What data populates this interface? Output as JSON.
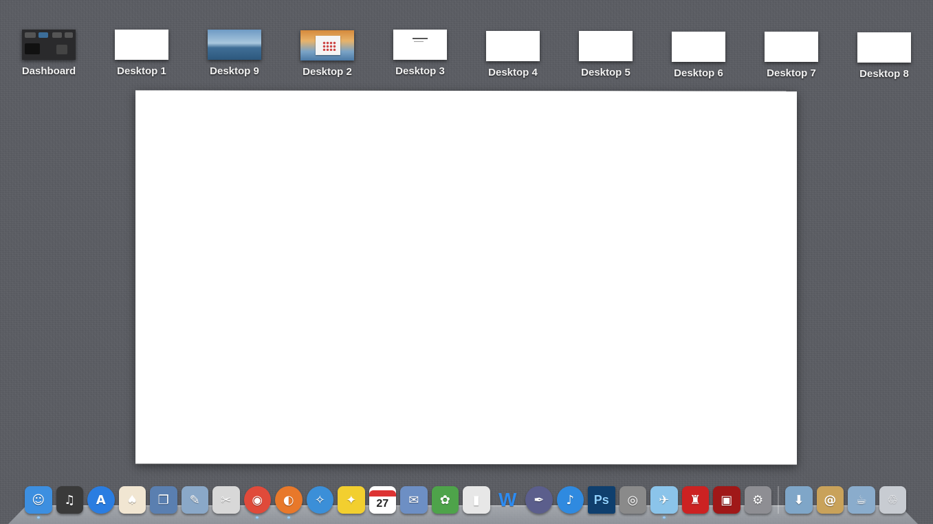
{
  "spaces": [
    {
      "label": "Dashboard",
      "kind": "dashboard"
    },
    {
      "label": "Desktop 1",
      "kind": "blank"
    },
    {
      "label": "Desktop 9",
      "kind": "ocean"
    },
    {
      "label": "Desktop 2",
      "kind": "sunset"
    },
    {
      "label": "Desktop 3",
      "kind": "doc"
    },
    {
      "label": "Desktop 4",
      "kind": "blank"
    },
    {
      "label": "Desktop 5",
      "kind": "blank"
    },
    {
      "label": "Desktop 6",
      "kind": "blank"
    },
    {
      "label": "Desktop 7",
      "kind": "blank"
    },
    {
      "label": "Desktop 8",
      "kind": "blank"
    }
  ],
  "dock": {
    "calendar_day": "27",
    "photoshop_label": "Ps",
    "word_label": "W",
    "apps": [
      {
        "name": "finder-icon",
        "color": "#3d8fe0",
        "glyph": "☺",
        "running": true
      },
      {
        "name": "dashboard-app-icon",
        "color": "#3a3a3a",
        "glyph": "♫",
        "running": false
      },
      {
        "name": "app-store-icon",
        "color": "#2a7de1",
        "glyph": "A",
        "round": true,
        "running": false
      },
      {
        "name": "solitaire-icon",
        "color": "#f1e6d2",
        "glyph": "♠",
        "running": false
      },
      {
        "name": "vmware-fusion-icon",
        "color": "#5a7fb0",
        "glyph": "❐",
        "running": false
      },
      {
        "name": "preview-icon",
        "color": "#8aa8c8",
        "glyph": "✎",
        "running": false
      },
      {
        "name": "scissors-app-icon",
        "color": "#d8d8d8",
        "glyph": "✂",
        "running": false
      },
      {
        "name": "chrome-icon",
        "color": "#e04a3a",
        "glyph": "◉",
        "round": true,
        "running": true
      },
      {
        "name": "firefox-icon",
        "color": "#e8782a",
        "glyph": "◐",
        "round": true,
        "running": true
      },
      {
        "name": "safari-icon",
        "color": "#3b8fd8",
        "glyph": "✧",
        "round": true,
        "running": false
      },
      {
        "name": "twitter-bird-icon",
        "color": "#f2cf2f",
        "glyph": "✦",
        "running": false
      },
      {
        "name": "calendar-icon",
        "color": "#ffffff",
        "glyph": "",
        "running": false
      },
      {
        "name": "mail-icon",
        "color": "#6d8fc4",
        "glyph": "✉",
        "running": false
      },
      {
        "name": "iphoto-icon",
        "color": "#4ea34a",
        "glyph": "✿",
        "running": false
      },
      {
        "name": "stocks-icon",
        "color": "#e7e7e7",
        "glyph": "▮",
        "running": false
      },
      {
        "name": "word-icon",
        "color": "#2d6fc3",
        "glyph": "",
        "running": false
      },
      {
        "name": "quill-icon",
        "color": "#5b5e8c",
        "glyph": "✒",
        "round": true,
        "running": false
      },
      {
        "name": "itunes-icon",
        "color": "#2f8ae0",
        "glyph": "♪",
        "round": true,
        "running": false
      },
      {
        "name": "photoshop-icon",
        "color": "#0f3f6e",
        "glyph": "",
        "running": false
      },
      {
        "name": "facetime-icon",
        "color": "#8a8a8a",
        "glyph": "◎",
        "running": false
      },
      {
        "name": "tweetie-icon",
        "color": "#8bc4ea",
        "glyph": "✈",
        "running": true
      },
      {
        "name": "red-chair-icon",
        "color": "#cc2222",
        "glyph": "♜",
        "running": false
      },
      {
        "name": "photo-booth-icon",
        "color": "#a01818",
        "glyph": "▣",
        "running": false
      },
      {
        "name": "system-preferences-icon",
        "color": "#8e8e93",
        "glyph": "⚙",
        "running": false
      }
    ],
    "stacks": [
      {
        "name": "downloads-folder-icon",
        "color": "#7fa6c8",
        "glyph": "⬇"
      },
      {
        "name": "address-book-icon",
        "color": "#c9a25a",
        "glyph": "@"
      },
      {
        "name": "applications-folder-icon",
        "color": "#8aaccc",
        "glyph": "☕"
      },
      {
        "name": "trash-icon",
        "color": "#c8ccd2",
        "glyph": "♲"
      }
    ]
  }
}
